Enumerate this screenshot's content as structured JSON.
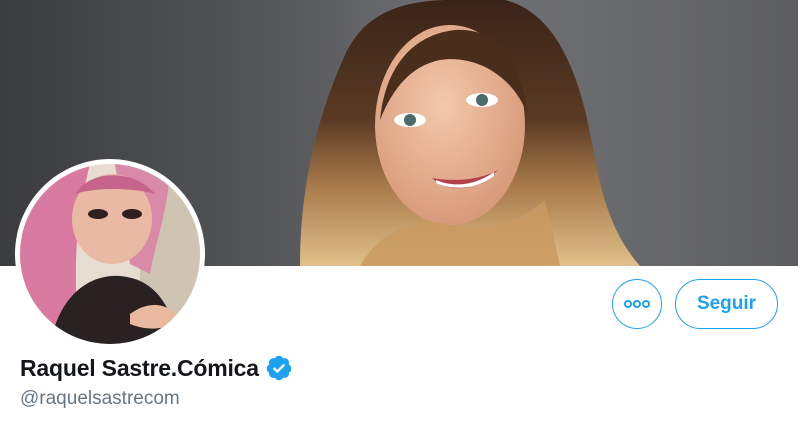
{
  "profile": {
    "display_name": "Raquel Sastre.Cómica",
    "handle": "@raquelsastrecom",
    "verified": true
  },
  "actions": {
    "more_icon": "more-horizontal-icon",
    "follow_label": "Seguir"
  },
  "colors": {
    "accent": "#1da1f2",
    "name_text": "#14171a",
    "handle_text": "#657786",
    "banner_background": "#5a5b5e"
  },
  "images": {
    "banner": "header-photo",
    "avatar": "profile-photo"
  }
}
